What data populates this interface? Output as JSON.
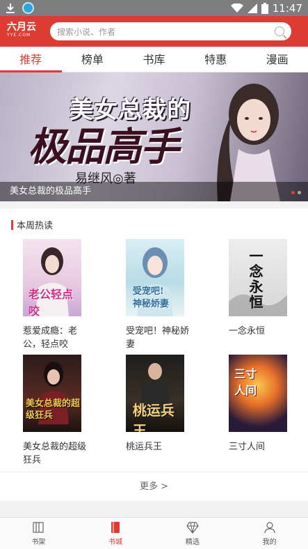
{
  "status_bar": {
    "time": "11:47"
  },
  "header": {
    "logo_main": "六月云",
    "logo_sub": "YYE.COM",
    "search_placeholder": "搜索小说、作者"
  },
  "tabs": [
    {
      "label": "推荐",
      "active": true
    },
    {
      "label": "榜单",
      "active": false
    },
    {
      "label": "书库",
      "active": false
    },
    {
      "label": "特惠",
      "active": false
    },
    {
      "label": "漫画",
      "active": false
    }
  ],
  "banner": {
    "title_line1": "美女总裁的",
    "title_line2": "极品高手",
    "author": "易继风◎著",
    "caption": "美女总裁的极品高手"
  },
  "weekly_hot": {
    "heading": "本周热读",
    "books": [
      {
        "title": "惹爱成瘾：老公，轻点咬",
        "cover_text": "老公轻点咬"
      },
      {
        "title": "受宠吧！神秘娇妻",
        "cover_text": "受宠吧!神秘娇妻"
      },
      {
        "title": "一念永恒",
        "cover_text": "一念永恒"
      },
      {
        "title": "美女总裁的超级狂兵",
        "cover_text": "美女总裁的超级狂兵"
      },
      {
        "title": "桃运兵王",
        "cover_text": "桃运兵王"
      },
      {
        "title": "三寸人间",
        "cover_text": "三寸人间"
      }
    ],
    "more_label": "更多 >"
  },
  "bottom_nav": [
    {
      "label": "书架",
      "icon": "bookshelf-icon",
      "active": false
    },
    {
      "label": "书城",
      "icon": "bookstore-icon",
      "active": true
    },
    {
      "label": "精选",
      "icon": "diamond-icon",
      "active": false
    },
    {
      "label": "我的",
      "icon": "profile-icon",
      "active": false
    }
  ],
  "colors": {
    "brand": "#dd3c33",
    "status_bar": "#7e7e7e"
  }
}
